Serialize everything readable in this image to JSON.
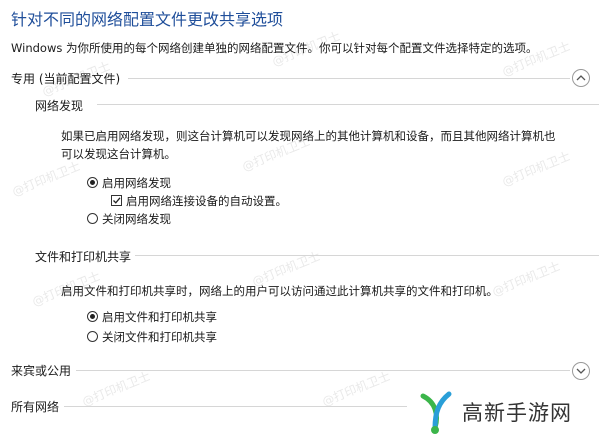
{
  "title": "针对不同的网络配置文件更改共享选项",
  "description": "Windows 为你所使用的每个网络创建单独的网络配置文件。你可以针对每个配置文件选择特定的选项。",
  "private_profile": {
    "header": "专用 (当前配置文件)",
    "network_discovery": {
      "heading": "网络发现",
      "description_line1": "如果已启用网络发现，则这台计算机可以发现网络上的其他计算机和设备，而且其他网络计算机也",
      "description_line2": "可以发现这台计算机。",
      "option_on": "启用网络发现",
      "auto_setup": "启用网络连接设备的自动设置。",
      "option_off": "关闭网络发现"
    },
    "file_printer_sharing": {
      "heading": "文件和打印机共享",
      "description": "启用文件和打印机共享时，网络上的用户可以访问通过此计算机共享的文件和打印机。",
      "option_on": "启用文件和打印机共享",
      "option_off": "关闭文件和打印机共享"
    }
  },
  "guest_public": {
    "header": "来宾或公用"
  },
  "all_networks": {
    "header": "所有网络"
  },
  "watermark": "@打印机卫士",
  "logo_text": "高新手游网",
  "colors": {
    "title": "#1f4e9a",
    "logo_green": "#3bb54a",
    "logo_blue": "#2a9fd8"
  }
}
